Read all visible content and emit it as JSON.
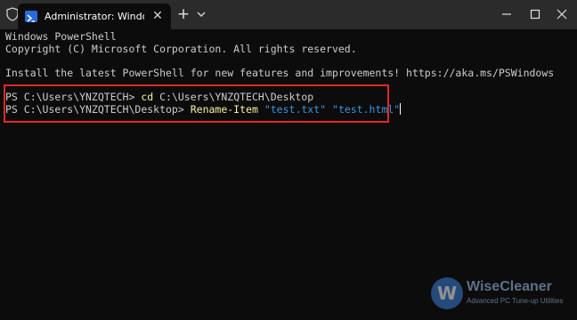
{
  "window": {
    "tab_title": "Administrator: Windows PowerShell",
    "tab_close": "✕",
    "new_tab": "+",
    "icons": [
      "shield-icon",
      "powershell-icon",
      "close-icon",
      "plus-icon",
      "chevron-down-icon",
      "minimize-icon",
      "maximize-icon",
      "window-close-icon"
    ]
  },
  "terminal": {
    "header_line1": "Windows PowerShell",
    "header_line2": "Copyright (C) Microsoft Corporation. All rights reserved.",
    "install_line": "Install the latest PowerShell for new features and improvements! https://aka.ms/PSWindows",
    "line1": {
      "prompt": "PS C:\\Users\\YNZQTECH> ",
      "command": "cd",
      "args": " C:\\Users\\YNZQTECH\\Desktop"
    },
    "line2": {
      "prompt": "PS C:\\Users\\YNZQTECH\\Desktop> ",
      "command": "Rename-Item",
      "space1": " ",
      "arg1": "\"test.txt\"",
      "space2": " ",
      "arg2": "\"test.html\""
    }
  },
  "watermark": {
    "logo_letter": "W",
    "name": "WiseCleaner",
    "tagline": "Advanced PC Tune-up Utilities"
  },
  "colors": {
    "background": "#0c0c0c",
    "titlebar": "#2b2b2b",
    "text": "#cccccc",
    "command": "#f9f1a5",
    "string": "#3a96dd",
    "highlight_border": "#e02828"
  }
}
